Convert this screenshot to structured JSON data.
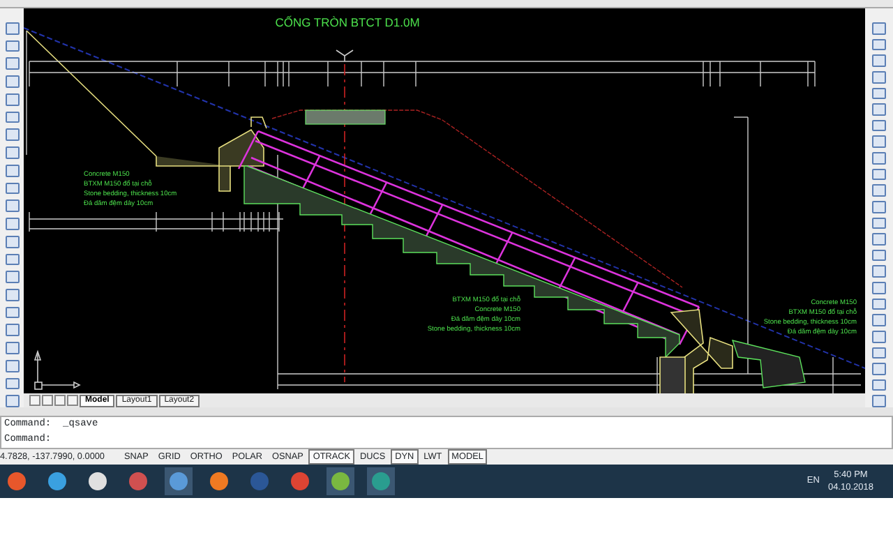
{
  "drawing": {
    "title": "CỐNG TRÒN BTCT D1.0M",
    "notes": [
      {
        "lines": [
          "Concrete M150",
          "BTXM M150 đổ tại chỗ",
          "Stone bedding, thickness 10cm",
          "Đá dăm đệm dày 10cm"
        ]
      },
      {
        "lines": [
          "BTXM M150 đổ tại chỗ",
          "Concrete M150",
          "Đá dăm đệm dày 10cm",
          "Stone bedding, thickness 10cm"
        ]
      },
      {
        "lines": [
          "Concrete M150",
          "BTXM M150 đổ tại chỗ",
          "Stone bedding, thickness 10cm",
          "Đá dăm đệm dày 10cm"
        ]
      }
    ]
  },
  "layout_tabs": [
    {
      "label": "Model",
      "selected": true
    },
    {
      "label": "Layout1",
      "selected": false
    },
    {
      "label": "Layout2",
      "selected": false
    }
  ],
  "command_lines": [
    "Command:  _qsave",
    "Command:"
  ],
  "status_bar": {
    "coordinates": "4.7828, -137.7990, 0.0000",
    "toggles": [
      {
        "label": "SNAP",
        "on": false
      },
      {
        "label": "GRID",
        "on": false
      },
      {
        "label": "ORTHO",
        "on": false
      },
      {
        "label": "POLAR",
        "on": false
      },
      {
        "label": "OSNAP",
        "on": false
      },
      {
        "label": "OTRACK",
        "on": true
      },
      {
        "label": "DUCS",
        "on": false
      },
      {
        "label": "DYN",
        "on": true
      },
      {
        "label": "LWT",
        "on": false
      },
      {
        "label": "MODEL",
        "on": true
      }
    ]
  },
  "taskbar": {
    "language": "EN",
    "time": "5:40 PM",
    "date": "04.10.2018"
  }
}
